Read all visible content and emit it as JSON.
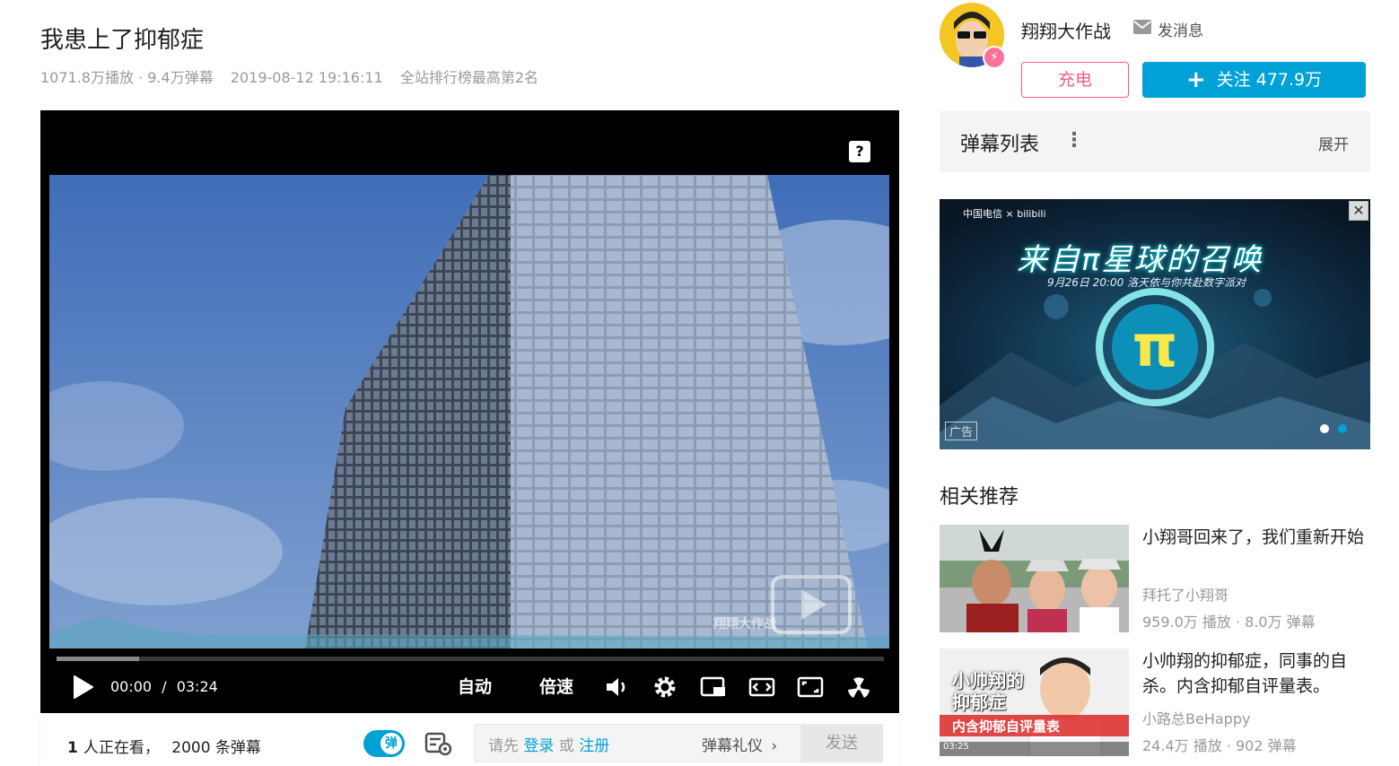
{
  "video": {
    "title": "我患上了抑郁症",
    "plays": "1071.8万播放 · 9.4万弹幕",
    "date": "2019-08-12 19:16:11",
    "rank": "全站排行榜最高第2名",
    "watermark": "翔翔大作战",
    "progress": 0.1
  },
  "player": {
    "time_current": "00:00",
    "time_separator": "/",
    "time_total": "03:24",
    "auto_label": "自动",
    "speed_label": "倍速"
  },
  "bottom": {
    "viewers_count": "1",
    "viewers_text": "人正在看，",
    "danmaku_count": "2000 条弹幕",
    "toggle_label": "弹",
    "hint_prefix": "请先",
    "login": "登录",
    "or": "或",
    "register": "注册",
    "etiquette": "弹幕礼仪",
    "send": "发送"
  },
  "uploader": {
    "name": "翔翔大作战",
    "message": "发消息",
    "charge": "充电",
    "follow": "关注 477.9万"
  },
  "danmaku_list": {
    "title": "弹幕列表",
    "expand": "展开"
  },
  "ad": {
    "brand": "中国电信 × bilibili",
    "headline": "来自π星球的召唤",
    "sub": "9月26日 20:00 洛天依与你共赴数字派对",
    "label": "广告"
  },
  "related": {
    "title": "相关推荐",
    "items": [
      {
        "title": "小翔哥回来了，我们重新开始",
        "up": "拜托了小翔哥",
        "stats": "959.0万 播放 · 8.0万 弹幕"
      },
      {
        "title": "小帅翔的抑郁症，同事的自杀。内含抑郁自评量表。",
        "up": "小路总BeHappy",
        "stats": "24.4万 播放 · 902 弹幕",
        "thumb_text1": "小帅翔的",
        "thumb_text2": "抑郁症",
        "thumb_banner": "内含抑郁自评量表",
        "thumb_duration": "03:25"
      }
    ]
  },
  "colors": {
    "accent": "#00a1d6",
    "pink": "#f25d8e"
  }
}
